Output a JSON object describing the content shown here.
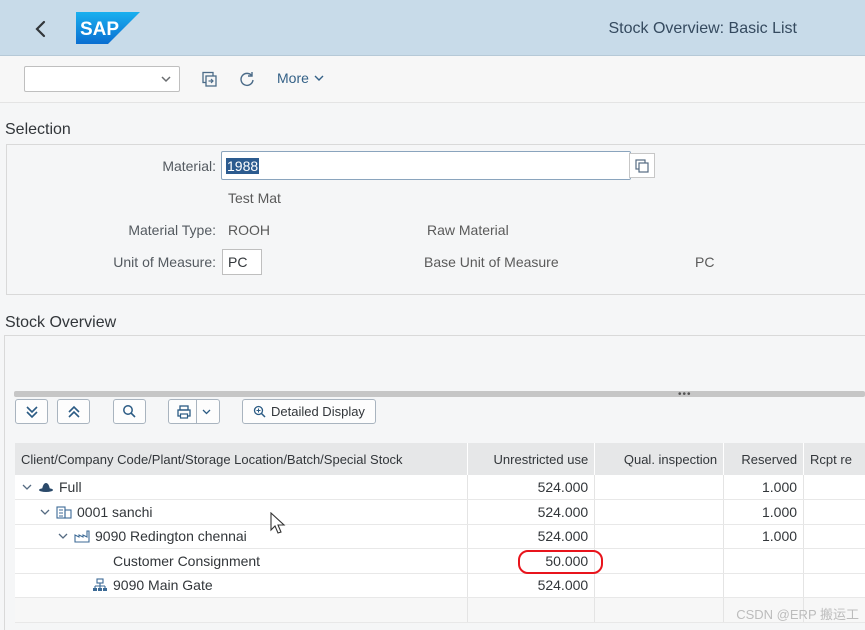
{
  "shell": {
    "title": "Stock Overview: Basic List",
    "logo_text": "SAP",
    "back_icon": "chevron-left-icon"
  },
  "toolbar": {
    "select_value": "",
    "more_label": "More"
  },
  "selection": {
    "title": "Selection",
    "material_label": "Material:",
    "material_value": "1988",
    "material_desc": "Test Mat",
    "material_type_label": "Material Type:",
    "material_type_value": "ROOH",
    "material_type_desc": "Raw Material",
    "uom_label": "Unit of Measure:",
    "uom_value": "PC",
    "base_uom_label": "Base Unit of Measure",
    "base_uom_value": "PC"
  },
  "stock": {
    "title": "Stock Overview",
    "detailed_display_label": "Detailed Display",
    "columns": [
      "Client/Company Code/Plant/Storage Location/Batch/Special Stock",
      "Unrestricted use",
      "Qual. inspection",
      "Reserved",
      "Rcpt re"
    ],
    "rows": [
      {
        "label": "Full",
        "unrestricted": "524.000",
        "qual": "",
        "reserved": "1.000"
      },
      {
        "label": "0001 sanchi",
        "unrestricted": "524.000",
        "qual": "",
        "reserved": "1.000"
      },
      {
        "label": "9090 Redington chennai",
        "unrestricted": "524.000",
        "qual": "",
        "reserved": "1.000"
      },
      {
        "label": "Customer Consignment",
        "unrestricted": "50.000",
        "qual": "",
        "reserved": ""
      },
      {
        "label": "9090 Main Gate",
        "unrestricted": "524.000",
        "qual": "",
        "reserved": ""
      }
    ]
  },
  "watermark": "CSDN @ERP 搬运工",
  "colors": {
    "shell_bg": "#c8dbe9",
    "accent": "#346187",
    "highlight_ring": "#e8141c"
  }
}
